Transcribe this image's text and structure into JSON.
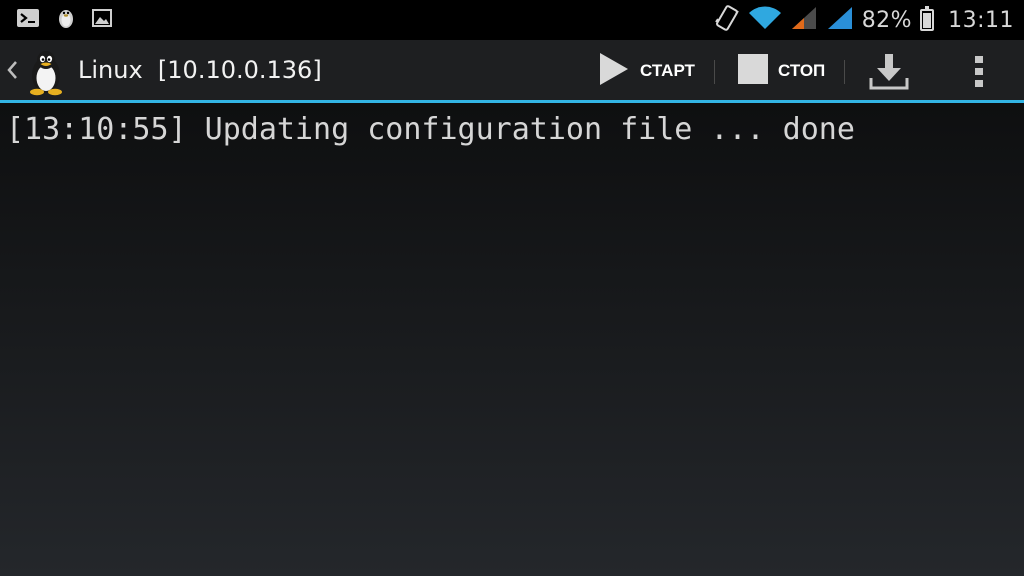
{
  "status_bar": {
    "notification_icons": [
      "terminal-icon",
      "tux-icon",
      "image-icon"
    ],
    "battery_percent": "82%",
    "battery_level": 0.82,
    "time": "13:11"
  },
  "action_bar": {
    "title": "Linux  [10.10.0.136]",
    "start_label": "СТАРТ",
    "stop_label": "СТОП",
    "accent_color": "#33b5e5"
  },
  "console": {
    "lines": [
      "[13:10:55] Updating configuration file ... done"
    ]
  }
}
